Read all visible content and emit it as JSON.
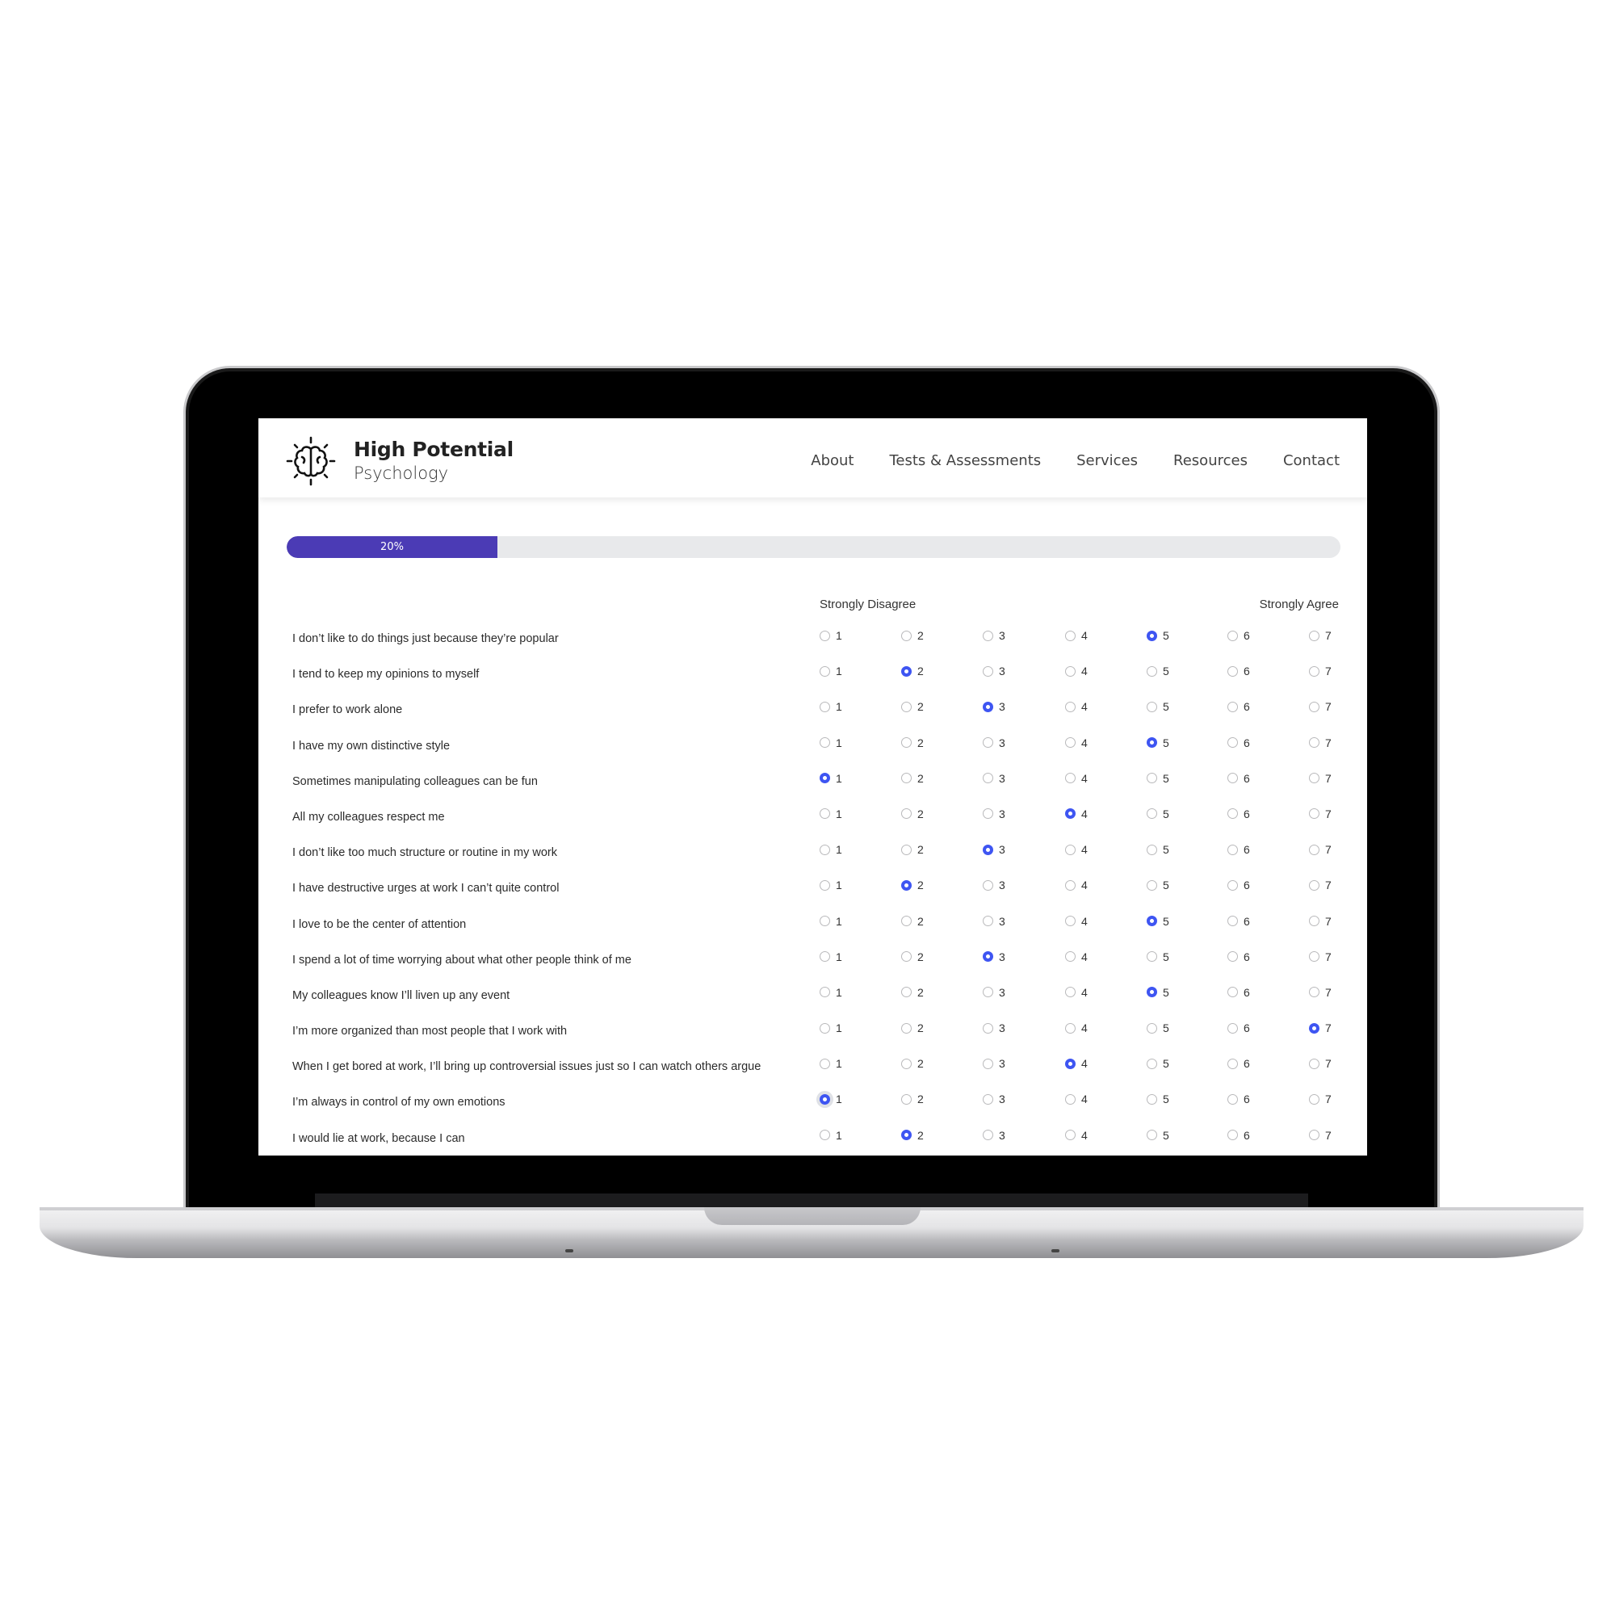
{
  "brand": {
    "title": "High Potential",
    "subtitle": "Psychology",
    "logo_icon": "brain-icon"
  },
  "nav": [
    {
      "label": "About"
    },
    {
      "label": "Tests & Assessments"
    },
    {
      "label": "Services"
    },
    {
      "label": "Resources"
    },
    {
      "label": "Contact"
    }
  ],
  "progress": {
    "value_percent": 20,
    "label": "20%",
    "fill_color": "#4b3bb5"
  },
  "scale": {
    "min_label": "Strongly Disagree",
    "max_label": "Strongly Agree",
    "options": [
      "1",
      "2",
      "3",
      "4",
      "5",
      "6",
      "7"
    ]
  },
  "accent_color": "#3e55f2",
  "questions": [
    {
      "text": "I don’t like to do things just because they’re popular",
      "selected": 5
    },
    {
      "text": "I tend to keep my opinions to myself",
      "selected": 2
    },
    {
      "text": "I prefer to work alone",
      "selected": 3
    },
    {
      "text": "I have my own distinctive style",
      "selected": 5
    },
    {
      "text": "Sometimes manipulating colleagues can be fun",
      "selected": 1
    },
    {
      "text": "All my colleagues respect me",
      "selected": 4
    },
    {
      "text": "I don’t like too much structure or routine in my work",
      "selected": 3
    },
    {
      "text": "I have destructive urges at work I can’t quite control",
      "selected": 2
    },
    {
      "text": "I love to be the center of attention",
      "selected": 5
    },
    {
      "text": "I spend a lot of time worrying about what other people think of me",
      "selected": 3
    },
    {
      "text": "My colleagues know I’ll liven up any event",
      "selected": 5
    },
    {
      "text": "I’m more organized than most people that I work with",
      "selected": 7
    },
    {
      "text": "When I get bored at work, I’ll bring up controversial issues just so I can watch others argue",
      "selected": 4
    },
    {
      "text": "I’m always in control of my own emotions",
      "selected": 1,
      "focused": true
    },
    {
      "text": "I would lie at work, because I can",
      "selected": 2
    }
  ]
}
